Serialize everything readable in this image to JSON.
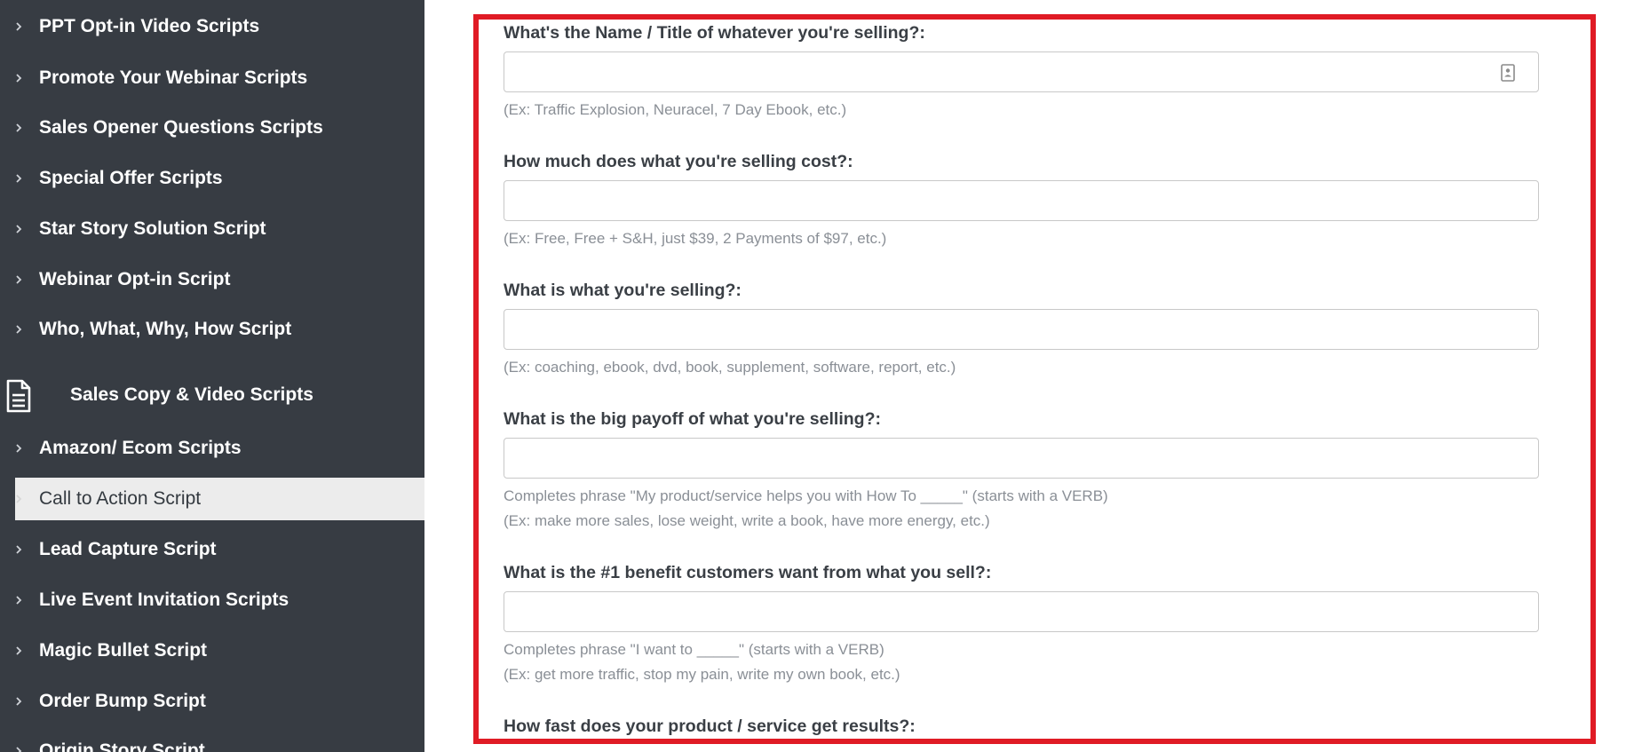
{
  "sidebar": {
    "items_top": [
      {
        "label": "PPT Opt-in Video Scripts"
      },
      {
        "label": "Promote Your Webinar Scripts"
      },
      {
        "label": "Sales Opener Questions Scripts"
      },
      {
        "label": "Special Offer Scripts"
      },
      {
        "label": "Star Story Solution Script"
      },
      {
        "label": "Webinar Opt-in Script"
      },
      {
        "label": "Who, What, Why, How Script"
      }
    ],
    "section": {
      "label": "Sales Copy & Video Scripts",
      "icon": "document-icon"
    },
    "items_bottom": [
      {
        "label": "Amazon/ Ecom Scripts"
      },
      {
        "label": "Call to Action Script",
        "active": true
      },
      {
        "label": "Lead Capture Script"
      },
      {
        "label": "Live Event Invitation Scripts"
      },
      {
        "label": "Magic Bullet Script"
      },
      {
        "label": "Order Bump Script"
      },
      {
        "label": "Origin Story Script"
      }
    ]
  },
  "form": {
    "accent_color": "#e01b25",
    "fields": [
      {
        "question": "What's the Name / Title of whatever you're selling?:",
        "value": "",
        "placeholder": "",
        "hints": [
          "(Ex: Traffic Explosion, Neuracel, 7 Day Ebook, etc.)"
        ]
      },
      {
        "question": "How much does what you're selling cost?:",
        "value": "",
        "placeholder": "",
        "hints": [
          "(Ex: Free, Free + S&H, just $39, 2 Payments of $97, etc.)"
        ]
      },
      {
        "question": "What is what you're selling?:",
        "value": "",
        "placeholder": "",
        "hints": [
          "(Ex: coaching, ebook, dvd, book, supplement, software, report, etc.)"
        ]
      },
      {
        "question": "What is the big payoff of what you're selling?:",
        "value": "",
        "placeholder": "",
        "hints": [
          "Completes phrase \"My product/service helps you with How To _____\" (starts with a VERB)",
          "(Ex: make more sales, lose weight, write a book, have more energy, etc.)"
        ]
      },
      {
        "question": "What is the #1 benefit customers want from what you sell?:",
        "value": "",
        "placeholder": "",
        "hints": [
          "Completes phrase \"I want to _____\" (starts with a VERB)",
          "(Ex: get more traffic, stop my pain, write my own book, etc.)"
        ]
      },
      {
        "question": "How fast does your product / service get results?:",
        "value": "",
        "placeholder": "",
        "hints": []
      }
    ]
  }
}
